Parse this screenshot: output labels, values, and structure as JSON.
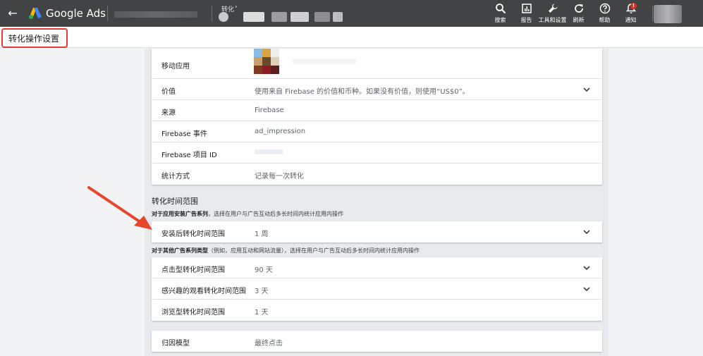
{
  "topbar": {
    "back_glyph": "←",
    "brand": "Google Ads",
    "breadcrumb_label": "转化",
    "breadcrumb_chevron": "›",
    "nav": [
      {
        "icon": "search-icon",
        "label": "搜索"
      },
      {
        "icon": "reports-icon",
        "label": "报告"
      },
      {
        "icon": "tools-icon",
        "label": "工具和设置"
      },
      {
        "icon": "refresh-icon",
        "label": "刷新"
      },
      {
        "icon": "help-icon",
        "label": "帮助"
      },
      {
        "icon": "bell-icon",
        "label": "通知"
      }
    ],
    "notification_badge": "!"
  },
  "page": {
    "title": "转化操作设置"
  },
  "details": [
    {
      "label": "移动应用",
      "value": ""
    },
    {
      "label": "价值",
      "value": "使用来自 Firebase 的价值和币种。如果没有价值，则使用“US$0”。"
    },
    {
      "label": "来源",
      "value": "Firebase"
    },
    {
      "label": "Firebase 事件",
      "value": "ad_impression"
    },
    {
      "label": "Firebase 项目 ID",
      "value": ""
    },
    {
      "label": "统计方式",
      "value": "记录每一次转化"
    }
  ],
  "window": {
    "title": "转化时间范围",
    "app_desc_bold": "对于应用安装广告系列",
    "app_desc": "，选择在用户与广告互动后多长时间内统计应用内操作",
    "install_label": "安装后转化时间范围",
    "install_value": "1 周",
    "other_desc_bold": "对于其他广告系列类型",
    "other_desc": "（例如，应用互动和网站流量），选择在用户与广告互动后多长时间内统计应用内操作",
    "click_label": "点击型转化时间范围",
    "click_value": "90 天",
    "engaged_label": "感兴趣的观看转化时间范围",
    "engaged_value": "3 天",
    "view_label": "浏览型转化时间范围",
    "view_value": "1 天"
  },
  "attribution": {
    "label": "归因模型",
    "value": "最终点击"
  },
  "colors": {
    "topbar": "#424345",
    "highlight": "#e53935",
    "panel": "#e8eaed",
    "arrow": "#e8462c"
  }
}
